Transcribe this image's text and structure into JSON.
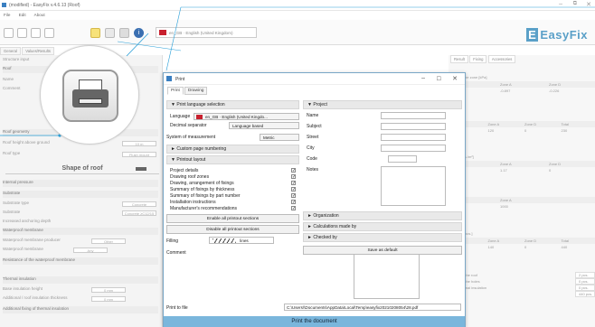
{
  "window": {
    "title": "(modified) - EasyFix v.4.6.13 (Roof)"
  },
  "menu": [
    "File",
    "Edit",
    "About"
  ],
  "toolbar": {
    "country": "en_GB · English (United Kingdom)"
  },
  "brand": {
    "prefix": "E",
    "name": "EasyFix"
  },
  "left_tabs": [
    "General",
    "Values/Results"
  ],
  "left_panel": {
    "rows": [
      "Structure input",
      "Roof",
      "Name",
      "Comment",
      "Roof geometry",
      "Roof height above ground",
      "Roof type"
    ],
    "shape": "Shape of roof",
    "lower_rows": [
      "Internal pressure",
      "Substrate",
      "Substrate type",
      "Substrate",
      "Increased anchoring depth",
      "Waterproof membrane",
      "Waterproof membrane producer",
      "Waterproof membrane",
      "Resistance of the waterproof membrane",
      "Thermal insulation",
      "Base insulation height",
      "Additional / roof insulation thickness",
      "Additional fixing of thermal insulation"
    ],
    "values": [
      "10 m",
      "Flush mount",
      "Concrete",
      "Concrete ≥C12/15",
      "Other",
      "Any",
      "0 mm",
      "0 mm"
    ]
  },
  "right_panel": {
    "tabs": [
      "Result",
      "Fixing",
      "Accessories"
    ],
    "section1": {
      "title": "casing in the zone [kPa]",
      "headers": [
        "Zone B",
        "Zone A",
        "Zone D"
      ],
      "row": [
        "-1.094",
        "-0.897",
        "-0.226"
      ]
    },
    "section2": {
      "title": "[m²]",
      "headers": [
        "Zone B",
        "Zone A",
        "Zone D",
        "Total"
      ],
      "row": [
        "90",
        "120",
        "0",
        "230"
      ]
    },
    "section3": {
      "title": "fixings [pcs./m²]",
      "headers": [
        "Zone B",
        "Zone A",
        "Zone D"
      ],
      "row": [
        "3.16",
        "1.17",
        "0"
      ]
    },
    "section4": {
      "title": "[mm]",
      "headers": [
        "Zone B",
        "Zone A"
      ],
      "row": [
        "414",
        "1000"
      ]
    },
    "section5": {
      "title": "of fixings [pcs.]",
      "headers": [
        "Zone B",
        "Zone A",
        "Zone D",
        "Total"
      ],
      "row": [
        "172",
        "140",
        "0",
        "440"
      ]
    },
    "bottom_rows": [
      {
        "label": "ening of the roof",
        "value": "2 pcs."
      },
      {
        "label": "ening of the holes",
        "value": "0 pcs."
      },
      {
        "label": "g of thermal insulation",
        "value": "0 pcs."
      },
      {
        "label": "",
        "value": "440 pcs."
      }
    ]
  },
  "dialog": {
    "title": "Print",
    "tabs": [
      "Print",
      "Drawing"
    ],
    "left": {
      "lang_section": "Print language selection",
      "language_label": "Language",
      "language_value": "en_GB · English (United Kingdo...",
      "decimal_label": "Decimal separator",
      "decimal_value": "Language based",
      "measure_label": "System of measurement",
      "measure_value": "Metric",
      "custom_section": "Custom page numbering",
      "layout_section": "Printout layout",
      "items": [
        "Project details",
        "Drawing roof zones",
        "Drawing, arrangement of fixings",
        "Summary of fixings by thickness",
        "Summary of fixings by part number",
        "Installation instructions",
        "Manufacturer's recommendations"
      ],
      "enable_all": "Enable all printout sections",
      "disable_all": "Disable all printout sections",
      "filling_label": "Filling",
      "filling_value": "lines",
      "comment_label": "Comment",
      "print_to_file_label": "Print to file",
      "print_to_file_path": "C:\\Users\\\\Documents\\AppData\\Local\\Temp\\easyfix20210208054\\28.pdf",
      "print_button": "Print the document"
    },
    "right": {
      "project_section": "Project",
      "fields": [
        "Name",
        "Subject",
        "Street",
        "City",
        "Code",
        "Notes"
      ],
      "organization": "Organization",
      "calculations": "Calculations made by",
      "checked": "Checked by",
      "save_default": "Save as default"
    }
  },
  "colors": {
    "accent": "#5aa0c8",
    "dialog_border": "#7aa7c7",
    "print_bar": "#7ab6dc"
  }
}
